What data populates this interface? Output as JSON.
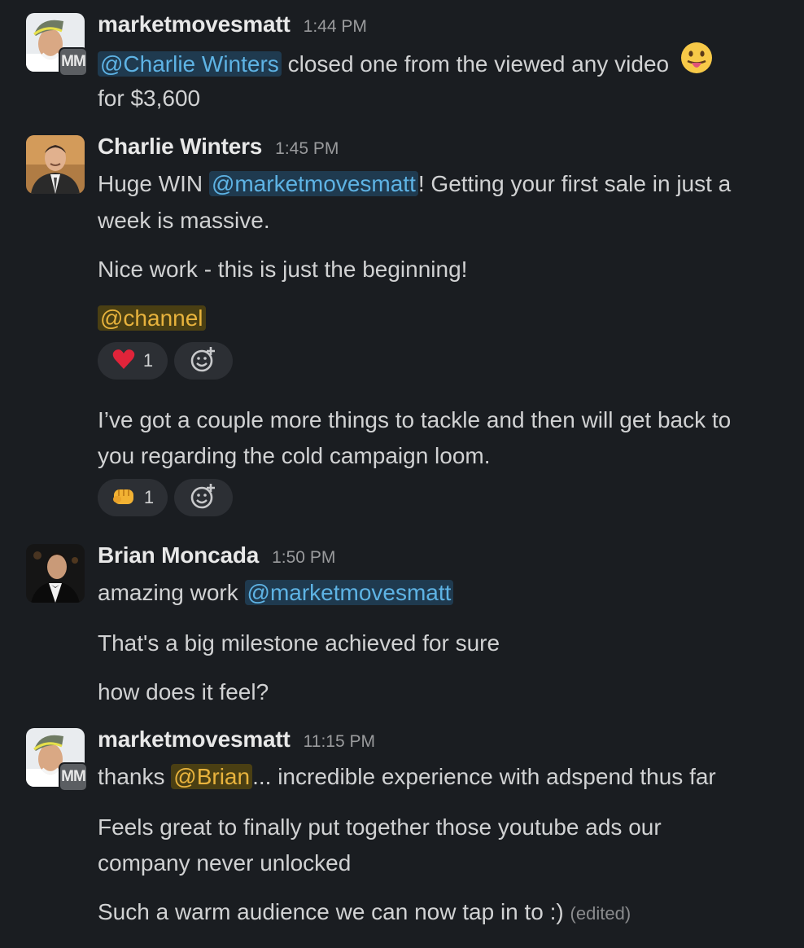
{
  "messages": [
    {
      "author": "marketmovesmatt",
      "time": "1:44 PM",
      "badge": "MM",
      "avatar_icon": "user-avatar-cap-icon",
      "lines": {
        "l1_mention": "@Charlie Winters",
        "l1_text": " closed one from the viewed any video ",
        "l1_emoji": "face-with-tongue-icon",
        "l2_text": "for $3,600"
      }
    },
    {
      "author": "Charlie Winters",
      "time": "1:45 PM",
      "avatar_icon": "user-avatar-suit-icon",
      "lines": {
        "l1_pre": "Huge WIN ",
        "l1_mention": "@marketmovesmatt",
        "l1_post": "! Getting your first sale in just a",
        "l2_text": "week is massive.",
        "l3_text": "Nice work - this is just the beginning!",
        "l4_mention": "@channel",
        "l5_text": "I’ve got a couple more things to tackle and then will get back to",
        "l6_text": "you regarding the cold campaign loom."
      },
      "reactions_1": {
        "emoji": "red-heart-icon",
        "count": "1"
      },
      "reactions_2": {
        "emoji": "fist-bump-icon",
        "count": "1"
      }
    },
    {
      "author": "Brian Moncada",
      "time": "1:50 PM",
      "avatar_icon": "user-avatar-tuxedo-icon",
      "lines": {
        "l1_pre": "amazing work ",
        "l1_mention": "@marketmovesmatt",
        "l2_text": "That's a big milestone achieved for sure",
        "l3_text": "how does it feel?"
      }
    },
    {
      "author": "marketmovesmatt",
      "time": "11:15 PM",
      "badge": "MM",
      "avatar_icon": "user-avatar-cap-icon",
      "lines": {
        "l1_pre": "thanks ",
        "l1_mention": "@Brian",
        "l1_post": "... incredible experience with adspend thus far",
        "l2_text": "Feels great to finally put together those youtube ads our",
        "l3_text": "company never unlocked",
        "l4_text": "Such a warm audience we can now tap in to :) ",
        "l4_edited": "(edited)"
      }
    }
  ],
  "colors": {
    "background": "#1a1d21",
    "mention_blue": "#5eb3e4",
    "mention_yellow": "#e8b33d",
    "reaction_bg": "#2c2f34"
  }
}
